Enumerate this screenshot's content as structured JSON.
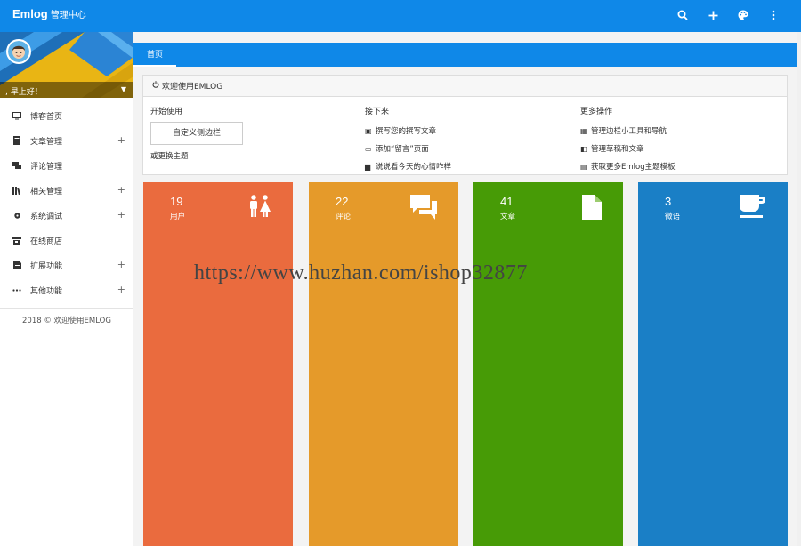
{
  "topbar": {
    "brand": "Emlog",
    "brand_sub": "管理中心",
    "icons": [
      "search-icon",
      "plus-icon",
      "palette-icon",
      "more-vert-icon"
    ]
  },
  "sidebar": {
    "greeting": ", 早上好！",
    "items": [
      {
        "label": "博客首页",
        "icon": "monitor-icon",
        "expandable": false
      },
      {
        "label": "文章管理",
        "icon": "book-icon",
        "expandable": true
      },
      {
        "label": "评论管理",
        "icon": "comments-icon",
        "expandable": false
      },
      {
        "label": "相关管理",
        "icon": "library-icon",
        "expandable": true
      },
      {
        "label": "系统调试",
        "icon": "gear-icon",
        "expandable": true
      },
      {
        "label": "在线商店",
        "icon": "store-icon",
        "expandable": false
      },
      {
        "label": "扩展功能",
        "icon": "puzzle-icon",
        "expandable": true
      },
      {
        "label": "其他功能",
        "icon": "more-horiz-icon",
        "expandable": true
      }
    ],
    "footer": "2018 © 欢迎使用EMLOG",
    "plus_symbol": "+"
  },
  "main": {
    "tab": "首页",
    "welcome": {
      "title": "欢迎使用EMLOG",
      "col1": {
        "heading": "开始使用",
        "button": "自定义侧边栏",
        "link": "或更换主题"
      },
      "col2": {
        "heading": "接下来",
        "items": [
          "撰写您的撰写文章",
          "添加“留言”页面",
          "说说看今天的心情咋样"
        ]
      },
      "col3": {
        "heading": "更多操作",
        "items": [
          "管理边栏小工具和导航",
          "管理草稿和文章",
          "获取更多Emlog主题模板"
        ]
      }
    },
    "cards": [
      {
        "count": "19",
        "label": "用户",
        "color": "#ea6b3e",
        "icon": "users-icon"
      },
      {
        "count": "22",
        "label": "评论",
        "color": "#e59a2a",
        "icon": "comments-icon"
      },
      {
        "count": "41",
        "label": "文章",
        "color": "#479b06",
        "icon": "document-icon"
      },
      {
        "count": "3",
        "label": "微语",
        "color": "#1a7fc6",
        "icon": "coffee-cup-icon"
      }
    ]
  },
  "watermark": "https://www.huzhan.com/ishop32877",
  "colors": {
    "primary": "#0f88e8",
    "sidebar_bg": "#ffffff",
    "page_bg": "#f3f3f3"
  }
}
